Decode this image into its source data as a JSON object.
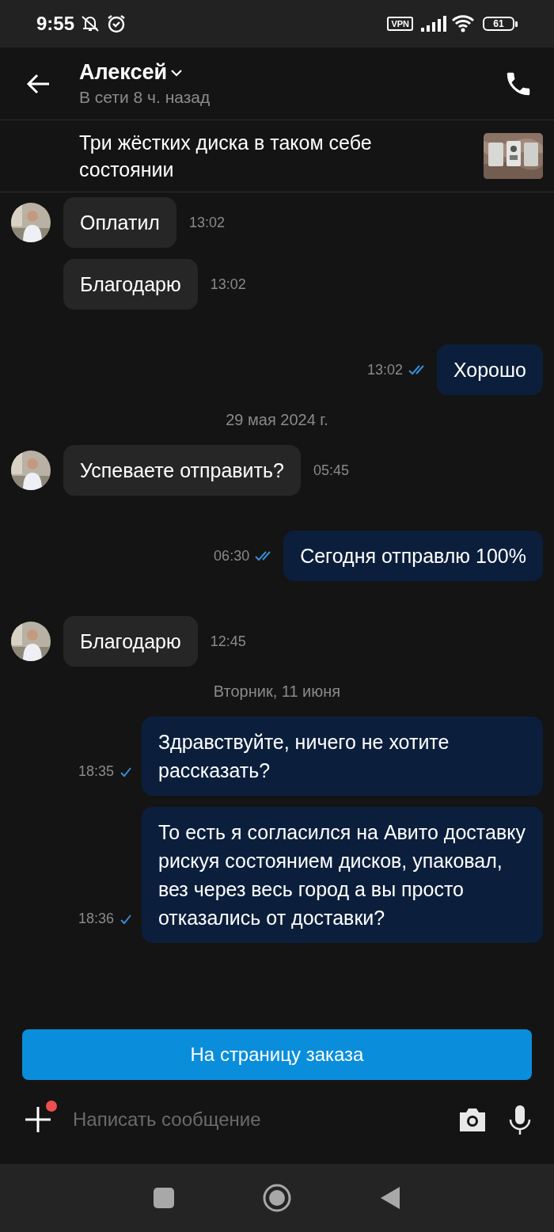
{
  "status_bar": {
    "time": "9:55",
    "battery": "61",
    "vpn": "VPN"
  },
  "header": {
    "name": "Алексей",
    "presence": "В сети 8 ч. назад"
  },
  "listing": {
    "title": "Три жёстких диска в таком себе состоянии"
  },
  "messages": [
    {
      "kind": "message",
      "outgoing": false,
      "avatar": true,
      "text": "Оплатил",
      "time": "13:02"
    },
    {
      "kind": "message",
      "outgoing": false,
      "avatar": false,
      "text": "Благодарю",
      "time": "13:02"
    },
    {
      "kind": "message",
      "outgoing": true,
      "read": true,
      "text": "Хорошо",
      "time": "13:02"
    },
    {
      "kind": "date",
      "text": "29 мая 2024 г."
    },
    {
      "kind": "message",
      "outgoing": false,
      "avatar": true,
      "text": "Успеваете отправить?",
      "time": "05:45"
    },
    {
      "kind": "message",
      "outgoing": true,
      "read": true,
      "text": "Сегодня отправлю 100%",
      "time": "06:30"
    },
    {
      "kind": "message",
      "outgoing": false,
      "avatar": true,
      "text": "Благодарю",
      "time": "12:45"
    },
    {
      "kind": "date",
      "text": "Вторник, 11 июня"
    },
    {
      "kind": "message",
      "outgoing": true,
      "read": false,
      "text": "Здравствуйте, ничего не хотите рассказать?",
      "time": "18:35"
    },
    {
      "kind": "message",
      "outgoing": true,
      "read": false,
      "text": "То есть я согласился на Авито доставку рискуя состоянием дисков, упаковал, вез через весь город а вы просто отказались от доставки?",
      "time": "18:36"
    }
  ],
  "order_button": {
    "label": "На страницу заказа"
  },
  "composer": {
    "placeholder": "Написать сообщение",
    "attach_badge": true
  }
}
